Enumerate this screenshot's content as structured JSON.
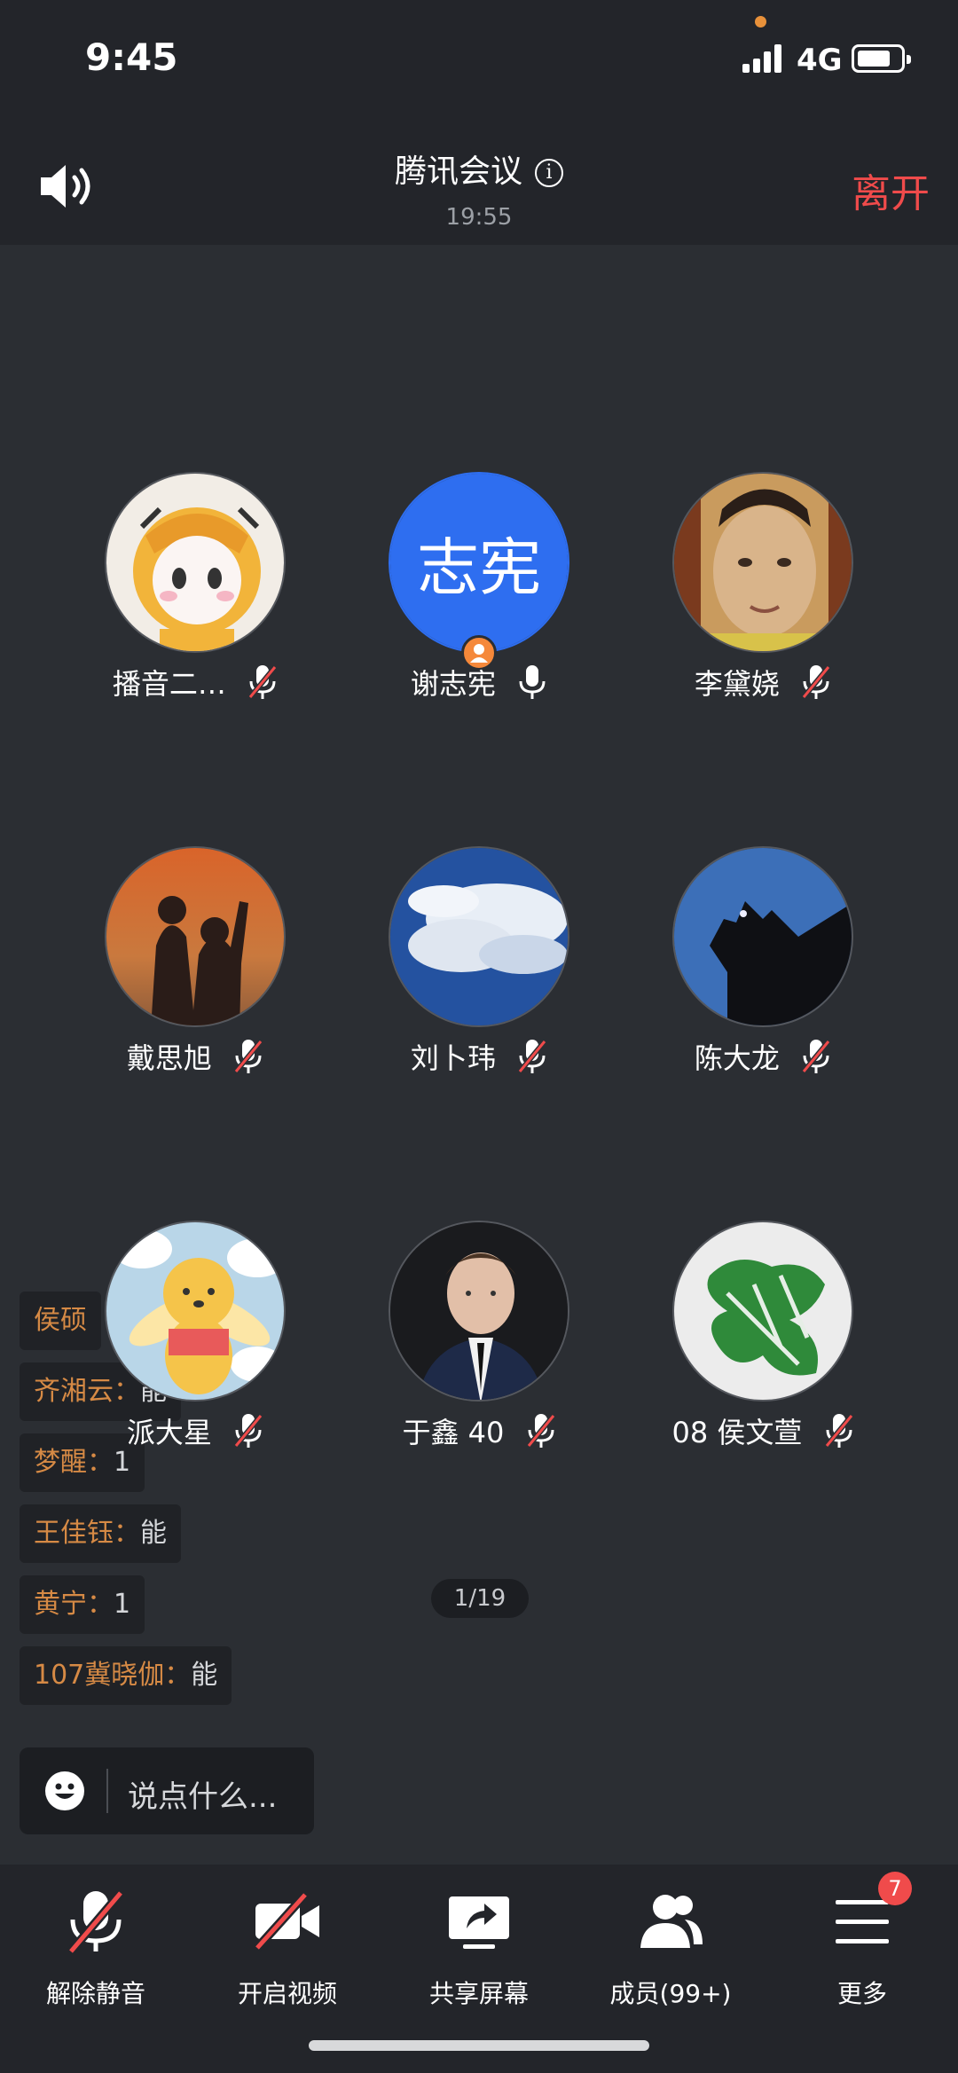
{
  "status_bar": {
    "time": "9:45",
    "network": "4G"
  },
  "header": {
    "title": "腾讯会议",
    "subtitle": "19:55",
    "leave_label": "离开"
  },
  "participants": [
    {
      "name": "播音二…",
      "mic": "muted"
    },
    {
      "name": "谢志宪",
      "mic": "on",
      "avatar_text": "志宪",
      "host": true
    },
    {
      "name": "李黛娆",
      "mic": "muted"
    },
    {
      "name": "戴思旭",
      "mic": "muted"
    },
    {
      "name": "刘卜玮",
      "mic": "muted"
    },
    {
      "name": "陈大龙",
      "mic": "muted"
    },
    {
      "name": "派大星",
      "mic": "muted"
    },
    {
      "name": "于鑫 40",
      "mic": "muted"
    },
    {
      "name": "08 侯文萱",
      "mic": "muted"
    }
  ],
  "chat_messages": [
    {
      "user": "侯硕",
      "text": ""
    },
    {
      "user": "齐湘云：",
      "text": "能"
    },
    {
      "user": "梦醒：",
      "text": "1"
    },
    {
      "user": "王佳钰：",
      "text": "能"
    },
    {
      "user": "黄宁：",
      "text": "1"
    },
    {
      "user": "107冀晓伽：",
      "text": "能"
    }
  ],
  "pager": "1/19",
  "chat_input": {
    "placeholder": "说点什么..."
  },
  "toolbar": [
    {
      "label": "解除静音",
      "icon": "mic-muted-icon"
    },
    {
      "label": "开启视频",
      "icon": "video-off-icon"
    },
    {
      "label": "共享屏幕",
      "icon": "share-screen-icon"
    },
    {
      "label": "成员(99+)",
      "icon": "members-icon"
    },
    {
      "label": "更多",
      "icon": "menu-icon",
      "badge": "7"
    }
  ],
  "colors": {
    "accent_red": "#f04b4b",
    "chat_user": "#d68a45",
    "avatar_blue": "#2e6ef0",
    "background": "#2b2e33"
  }
}
